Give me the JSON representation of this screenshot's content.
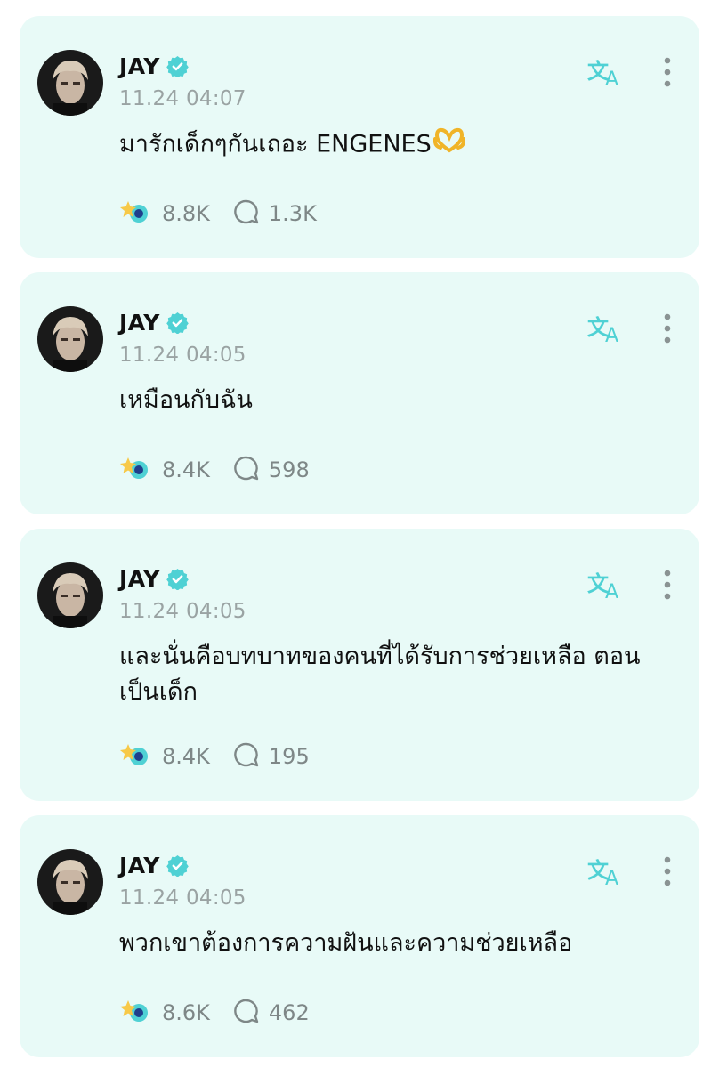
{
  "posts": [
    {
      "author": "JAY",
      "time": "11.24 04:07",
      "text": "มารักเด็กๆกันเถอะ ENGENES",
      "has_heart_hands_emoji": true,
      "likes": "8.8K",
      "comments": "1.3K"
    },
    {
      "author": "JAY",
      "time": "11.24 04:05",
      "text": "เหมือนกับฉัน",
      "has_heart_hands_emoji": false,
      "likes": "8.4K",
      "comments": "598"
    },
    {
      "author": "JAY",
      "time": "11.24 04:05",
      "text": "และนั่นคือบทบาทของคนที่ได้รับการช่วยเหลือ ตอนเป็นเด็ก",
      "has_heart_hands_emoji": false,
      "likes": "8.4K",
      "comments": "195"
    },
    {
      "author": "JAY",
      "time": "11.24 04:05",
      "text": "พวกเขาต้องการความฝันและความช่วยเหลือ",
      "has_heart_hands_emoji": false,
      "likes": "8.6K",
      "comments": "462"
    }
  ],
  "icons": {
    "verified": "verified-badge-icon",
    "translate": "translate-icon",
    "more": "more-vertical-icon",
    "like": "sparkle-like-icon",
    "comment": "comment-bubble-icon"
  },
  "colors": {
    "card_background": "#e8faf7",
    "accent": "#4fd1d4",
    "verified": "#4fd1d4",
    "muted_text": "#9aa3a3"
  }
}
